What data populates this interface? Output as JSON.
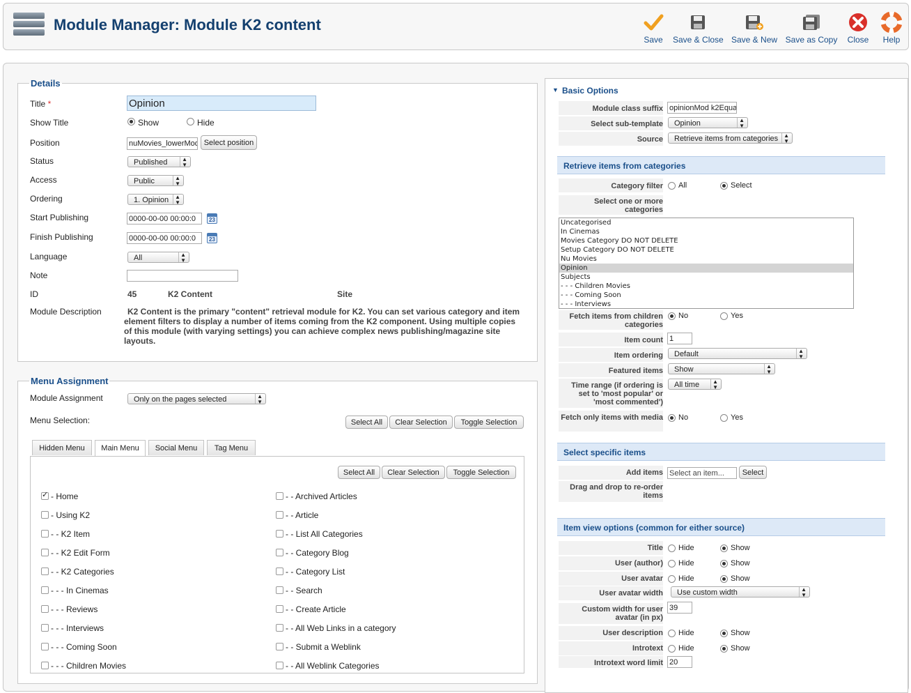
{
  "header": {
    "title": "Module Manager: Module K2 content",
    "toolbar": [
      {
        "label": "Save",
        "icon": "check-icon"
      },
      {
        "label": "Save & Close",
        "icon": "floppy-icon"
      },
      {
        "label": "Save & New",
        "icon": "floppy-plus-icon"
      },
      {
        "label": "Save as Copy",
        "icon": "floppy-copy-icon"
      },
      {
        "label": "Close",
        "icon": "close-icon"
      },
      {
        "label": "Help",
        "icon": "lifebuoy-icon"
      }
    ]
  },
  "details": {
    "legend": "Details",
    "title_label": "Title",
    "title_required": "*",
    "title_value": "Opinion",
    "show_title_label": "Show Title",
    "show_label": "Show",
    "hide_label": "Hide",
    "position_label": "Position",
    "position_value": "nuMovies_lowerMod",
    "select_position": "Select position",
    "status_label": "Status",
    "status_value": "Published",
    "access_label": "Access",
    "access_value": "Public",
    "ordering_label": "Ordering",
    "ordering_value": "1. Opinion",
    "start_label": "Start Publishing",
    "start_value": "0000-00-00 00:00:0",
    "finish_label": "Finish Publishing",
    "finish_value": "0000-00-00 00:00:0",
    "calendar_text": "23",
    "language_label": "Language",
    "language_value": "All",
    "note_label": "Note",
    "note_value": "",
    "id_label": "ID",
    "id_value": "45",
    "id_type": "K2 Content",
    "id_client": "Site",
    "desc_label": "Module Description",
    "desc_text": "K2 Content is the primary \"content\" retrieval module for K2. You can set various category and item element filters to display a number of items coming from the K2 component. Using multiple copies of this module (with varying settings) you can achieve complex news publishing/magazine site layouts."
  },
  "menu": {
    "legend": "Menu Assignment",
    "assignment_label": "Module Assignment",
    "assignment_value": "Only on the pages selected",
    "selection_label": "Menu Selection:",
    "select_all": "Select All",
    "clear_selection": "Clear Selection",
    "toggle_selection": "Toggle Selection",
    "tabs": [
      "Hidden Menu",
      "Main Menu",
      "Social Menu",
      "Tag Menu"
    ],
    "left_items": [
      {
        "label": "- Home",
        "checked": true
      },
      {
        "label": "- Using K2",
        "checked": false
      },
      {
        "label": "- - K2 Item",
        "checked": false
      },
      {
        "label": "- - K2 Edit Form",
        "checked": false
      },
      {
        "label": "- - K2 Categories",
        "checked": false
      },
      {
        "label": "- - - In Cinemas",
        "checked": false
      },
      {
        "label": "- - - Reviews",
        "checked": false
      },
      {
        "label": "- - - Interviews",
        "checked": false
      },
      {
        "label": "- - - Coming Soon",
        "checked": false
      },
      {
        "label": "- - - Children Movies",
        "checked": false
      }
    ],
    "right_items": [
      {
        "label": "- - Archived Articles",
        "checked": false
      },
      {
        "label": "- - Article",
        "checked": false
      },
      {
        "label": "- - List All Categories",
        "checked": false
      },
      {
        "label": "- - Category Blog",
        "checked": false
      },
      {
        "label": "- - Category List",
        "checked": false
      },
      {
        "label": "- - Search",
        "checked": false
      },
      {
        "label": "- - Create Article",
        "checked": false
      },
      {
        "label": "- - All Web Links in a category",
        "checked": false
      },
      {
        "label": "- - Submit a Weblink",
        "checked": false
      },
      {
        "label": "- - All Weblink Categories",
        "checked": false
      }
    ]
  },
  "options": {
    "section_title": "Basic Options",
    "class_suffix_label": "Module class suffix",
    "class_suffix_value": "opinionMod k2Equa",
    "subtemplate_label": "Select sub-template",
    "subtemplate_value": "Opinion",
    "source_label": "Source",
    "source_value": "Retrieve items from categories",
    "retrieve_header": "Retrieve items from categories",
    "category_filter_label": "Category filter",
    "all_label": "All",
    "select_label": "Select",
    "categories_label": "Select one or more categories",
    "categories": [
      "Uncategorised",
      "In Cinemas",
      "Movies Category DO NOT DELETE",
      "Setup Category DO NOT DELETE",
      "Nu Movies",
      "Opinion",
      "Subjects",
      "- - - Children Movies",
      "- - - Coming Soon",
      "- - - Interviews"
    ],
    "selected_category": "Opinion",
    "fetch_children_label": "Fetch items from children categories",
    "no_label": "No",
    "yes_label": "Yes",
    "item_count_label": "Item count",
    "item_count_value": "1",
    "item_ordering_label": "Item ordering",
    "item_ordering_value": "Default",
    "featured_label": "Featured items",
    "featured_value": "Show",
    "time_range_label": "Time range (if ordering is set to 'most popular' or 'most commented')",
    "time_range_value": "All time",
    "fetch_media_label": "Fetch only items with media",
    "specific_header": "Select specific items",
    "add_items_label": "Add items",
    "add_items_placeholder": "Select an item...",
    "select_button": "Select",
    "drag_label": "Drag and drop to re-order items",
    "view_header": "Item view options (common for either source)",
    "hide_label": "Hide",
    "show_label": "Show",
    "title_label": "Title",
    "user_author_label": "User (author)",
    "user_avatar_label": "User avatar",
    "avatar_width_label": "User avatar width",
    "avatar_width_value": "Use custom width",
    "custom_width_label": "Custom width for user avatar (in px)",
    "custom_width_value": "39",
    "user_desc_label": "User description",
    "introtext_label": "Introtext",
    "word_limit_label": "Introtext word limit",
    "word_limit_value": "20"
  }
}
